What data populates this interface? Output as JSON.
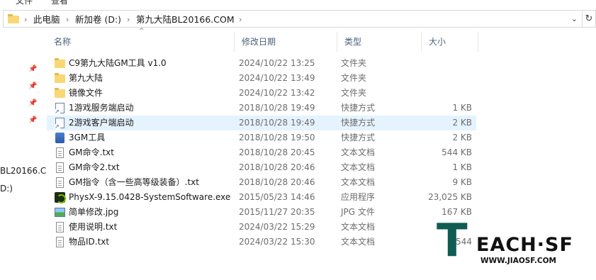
{
  "ribbon_fragment": [
    "文件",
    "查看"
  ],
  "address": {
    "crumbs": [
      "此电脑",
      "新加卷 (D:)",
      "第九大陆BL20166.COM"
    ],
    "separator": "›"
  },
  "nav": {
    "truncated_items": [
      "BL20166.C",
      "D:)"
    ]
  },
  "columns": {
    "name": "名称",
    "date": "修改日期",
    "type": "类型",
    "size": "大小"
  },
  "files": [
    {
      "icon": "folder-icon",
      "name": "C9第九大陆GM工具 v1.0",
      "date": "2024/10/22 13:25",
      "type": "文件夹",
      "size": ""
    },
    {
      "icon": "folder-icon",
      "name": "第九大陆",
      "date": "2024/10/22 13:49",
      "type": "文件夹",
      "size": ""
    },
    {
      "icon": "folder-icon",
      "name": "镜像文件",
      "date": "2024/10/22 13:42",
      "type": "文件夹",
      "size": ""
    },
    {
      "icon": "shortcut-icon",
      "name": "1游戏服务端启动",
      "date": "2018/10/28 19:49",
      "type": "快捷方式",
      "size": "1 KB"
    },
    {
      "icon": "shortcut-icon",
      "name": "2游戏客户端启动",
      "date": "2018/10/28 19:49",
      "type": "快捷方式",
      "size": "2 KB",
      "selected": true
    },
    {
      "icon": "app-shortcut-icon",
      "name": "3GM工具",
      "date": "2018/10/28 19:50",
      "type": "快捷方式",
      "size": "2 KB"
    },
    {
      "icon": "text-file-icon",
      "name": "GM命令.txt",
      "date": "2018/10/28 20:45",
      "type": "文本文档",
      "size": "544 KB"
    },
    {
      "icon": "text-file-icon",
      "name": "GM命令2.txt",
      "date": "2018/10/28 20:46",
      "type": "文本文档",
      "size": "1 KB"
    },
    {
      "icon": "text-file-icon",
      "name": "GM指令（含一些高等级装备）.txt",
      "date": "2018/10/28 20:46",
      "type": "文本文档",
      "size": "9 KB"
    },
    {
      "icon": "exe-icon",
      "name": "PhysX-9.15.0428-SystemSoftware.exe",
      "date": "2015/05/23 14:46",
      "type": "应用程序",
      "size": "23,025 KB"
    },
    {
      "icon": "image-file-icon",
      "name": "简单修改.jpg",
      "date": "2015/11/27 20:35",
      "type": "JPG 文件",
      "size": "167 KB"
    },
    {
      "icon": "text-file-icon",
      "name": "使用说明.txt",
      "date": "2024/03/22 15:29",
      "type": "文本文档",
      "size": ""
    },
    {
      "icon": "text-file-icon",
      "name": "物品ID.txt",
      "date": "2024/03/22 15:30",
      "type": "文本文档",
      "size": "544"
    }
  ],
  "watermark": {
    "mark": "T",
    "brand": "EACH·SF",
    "url": "WWW.JIAOSF.COM"
  },
  "colors": {
    "selected_row": "#e5f3ff",
    "folder": "#f8d775",
    "header_text": "#4c607a",
    "watermark_green": "#0f5c52"
  }
}
